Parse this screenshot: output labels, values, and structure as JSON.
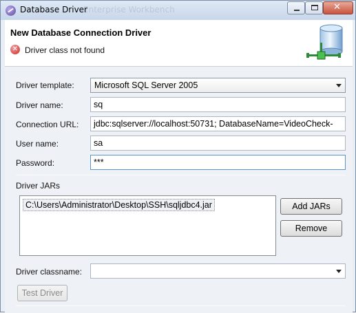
{
  "window": {
    "title": "Database Driver",
    "ghost_title": "Enterprise Workbench"
  },
  "header": {
    "title": "New Database Connection Driver",
    "error_message": "Driver class not found",
    "banner_icon": "database-network-icon"
  },
  "form": {
    "driver_template_label": "Driver template:",
    "driver_template_value": "Microsoft SQL Server 2005",
    "driver_name_label": "Driver name:",
    "driver_name_value": "sq",
    "connection_url_label": "Connection URL:",
    "connection_url_value": "jdbc:sqlserver://localhost:50731; DatabaseName=VideoCheck-",
    "user_name_label": "User name:",
    "user_name_value": "sa",
    "password_label": "Password:",
    "password_value": "***"
  },
  "jars": {
    "section_label": "Driver JARs",
    "items": [
      "C:\\Users\\Administrator\\Desktop\\SSH\\sqljdbc4.jar"
    ],
    "add_button": "Add JARs",
    "remove_button": "Remove"
  },
  "classname": {
    "label": "Driver classname:",
    "value": ""
  },
  "test_button": "Test Driver",
  "colors": {
    "accent_focus": "#5c93c8",
    "error_red": "#cc2b2b",
    "window_bg": "#eef2f7"
  }
}
